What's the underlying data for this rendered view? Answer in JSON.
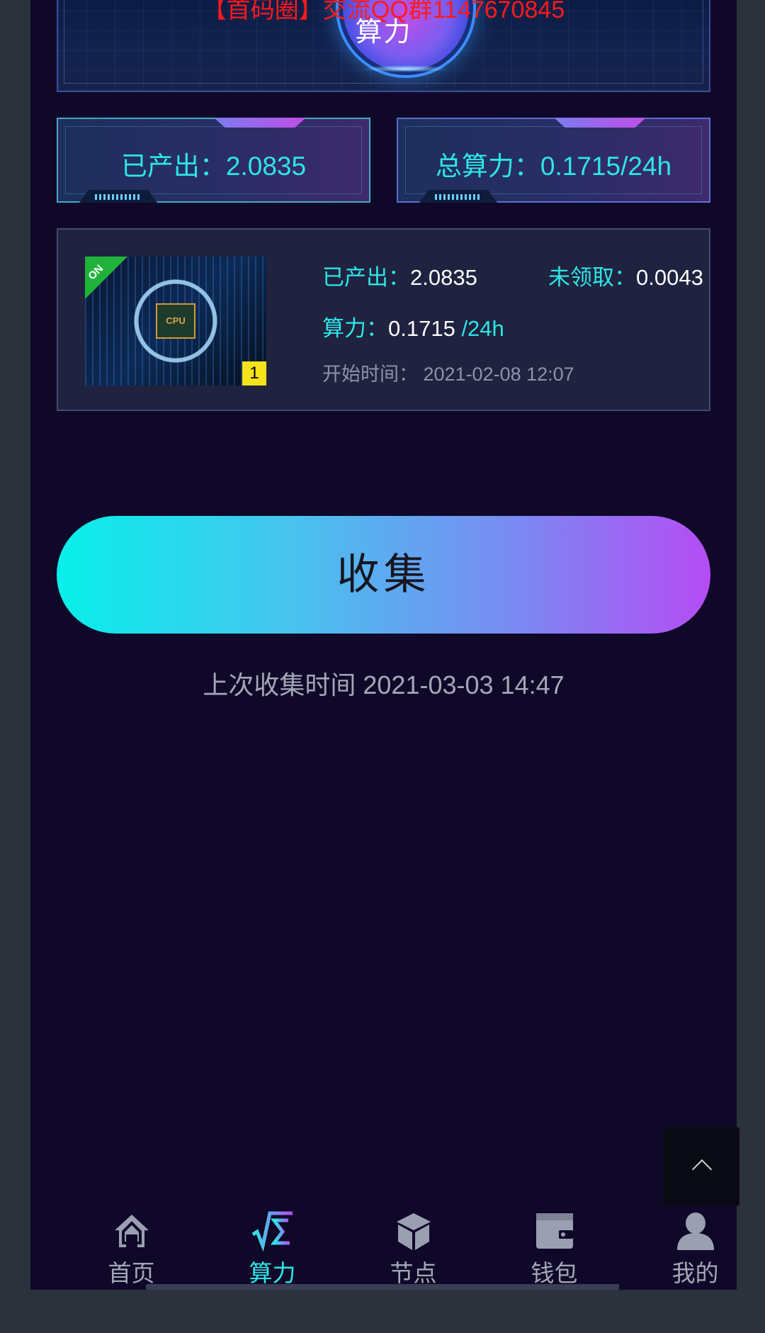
{
  "hero": {
    "notice": "【首码圈】交流QQ群1147670845",
    "orb_label": "算力"
  },
  "stats": {
    "produced_label": "已产出：",
    "produced_value": "2.0835",
    "total_power_label": "总算力：",
    "total_power_value": "0.1715/24h"
  },
  "miner": {
    "on_badge": "ON",
    "chip_text": "CPU",
    "level_badge": "1",
    "produced_label": "已产出：",
    "produced_value": "2.0835",
    "unclaimed_label": "未领取：",
    "unclaimed_value": "0.0043",
    "power_label": "算力：",
    "power_value": "0.1715",
    "power_unit": " /24h",
    "start_label": "开始时间：",
    "start_value": " 2021-02-08 12:07"
  },
  "collect": {
    "button_label": "收集",
    "last_label": "上次收集时间 2021-03-03 14:47"
  },
  "nav": {
    "items": [
      {
        "label": "首页",
        "icon": "home-icon"
      },
      {
        "label": "算力",
        "icon": "sqrt-sigma-icon",
        "active": true
      },
      {
        "label": "节点",
        "icon": "cube-icon"
      },
      {
        "label": "钱包",
        "icon": "wallet-icon"
      },
      {
        "label": "我的",
        "icon": "user-icon"
      }
    ]
  },
  "colors": {
    "background": "#100828",
    "accent_cyan": "#2ee6e6",
    "accent_purple": "#b54cf4",
    "notice_red": "#ff1a1a"
  }
}
